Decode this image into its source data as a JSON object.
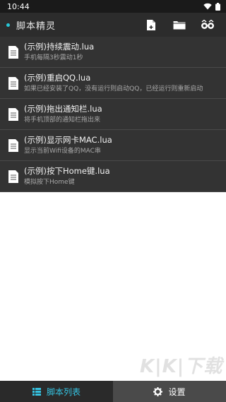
{
  "statusbar": {
    "time": "10:44"
  },
  "appbar": {
    "title": "脚本精灵"
  },
  "scripts": [
    {
      "name": "(示例)持续震动.lua",
      "desc": "手机每隔3秒震动1秒"
    },
    {
      "name": "(示例)重启QQ.lua",
      "desc": "如果已经安装了QQ，没有运行则启动QQ，已经运行则重新启动"
    },
    {
      "name": "(示例)拖出通知栏.lua",
      "desc": "将手机顶部的通知栏拖出来"
    },
    {
      "name": "(示例)显示网卡MAC.lua",
      "desc": "显示当前Wifi设备的MAC串"
    },
    {
      "name": "(示例)按下Home键.lua",
      "desc": "模拟按下Home键"
    }
  ],
  "bottomnav": {
    "scripts_tab": "脚本列表",
    "settings_tab": "设置"
  },
  "watermark": "K|K|下载",
  "colors": {
    "accent": "#35c2e0",
    "list_bg": "#333333",
    "appbar_bg": "#2c2c2c"
  }
}
